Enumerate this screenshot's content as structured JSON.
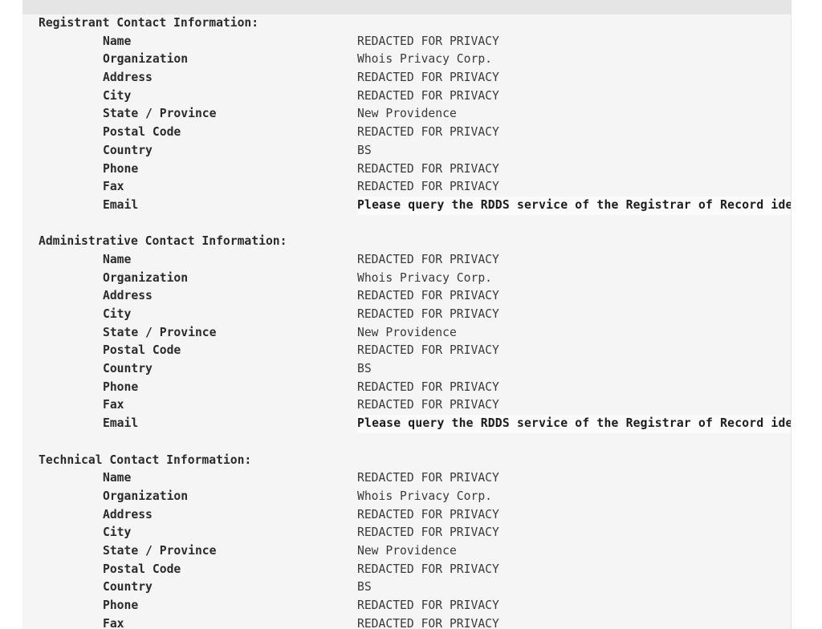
{
  "document": {
    "type": "whois-record",
    "background_color": "#f5f5f5",
    "top_band_color": "#e5e5e5",
    "page_background_color": "#ffffff",
    "text_color": "#2f2f2f"
  },
  "sections": [
    {
      "heading": "Registrant Contact Information:",
      "fields": [
        {
          "label": "Name",
          "value": "REDACTED FOR PRIVACY"
        },
        {
          "label": "Organization",
          "value": "Whois Privacy Corp."
        },
        {
          "label": "Address",
          "value": "REDACTED FOR PRIVACY"
        },
        {
          "label": "City",
          "value": "REDACTED FOR PRIVACY"
        },
        {
          "label": "State / Province",
          "value": "New Providence"
        },
        {
          "label": "Postal Code",
          "value": "REDACTED FOR PRIVACY"
        },
        {
          "label": "Country",
          "value": "BS"
        },
        {
          "label": "Phone",
          "value": "REDACTED FOR PRIVACY"
        },
        {
          "label": "Fax",
          "value": "REDACTED FOR PRIVACY"
        },
        {
          "label": "Email",
          "value": "Please query the RDDS service of the Registrar of Record identified",
          "emphasis": true
        }
      ]
    },
    {
      "heading": "Administrative Contact Information:",
      "fields": [
        {
          "label": "Name",
          "value": "REDACTED FOR PRIVACY"
        },
        {
          "label": "Organization",
          "value": "Whois Privacy Corp."
        },
        {
          "label": "Address",
          "value": "REDACTED FOR PRIVACY"
        },
        {
          "label": "City",
          "value": "REDACTED FOR PRIVACY"
        },
        {
          "label": "State / Province",
          "value": "New Providence"
        },
        {
          "label": "Postal Code",
          "value": "REDACTED FOR PRIVACY"
        },
        {
          "label": "Country",
          "value": "BS"
        },
        {
          "label": "Phone",
          "value": "REDACTED FOR PRIVACY"
        },
        {
          "label": "Fax",
          "value": "REDACTED FOR PRIVACY"
        },
        {
          "label": "Email",
          "value": "Please query the RDDS service of the Registrar of Record identified",
          "emphasis": true
        }
      ]
    },
    {
      "heading": "Technical Contact Information:",
      "fields": [
        {
          "label": "Name",
          "value": "REDACTED FOR PRIVACY"
        },
        {
          "label": "Organization",
          "value": "Whois Privacy Corp."
        },
        {
          "label": "Address",
          "value": "REDACTED FOR PRIVACY"
        },
        {
          "label": "City",
          "value": "REDACTED FOR PRIVACY"
        },
        {
          "label": "State / Province",
          "value": "New Providence"
        },
        {
          "label": "Postal Code",
          "value": "REDACTED FOR PRIVACY"
        },
        {
          "label": "Country",
          "value": "BS"
        },
        {
          "label": "Phone",
          "value": "REDACTED FOR PRIVACY"
        },
        {
          "label": "Fax",
          "value": "REDACTED FOR PRIVACY"
        }
      ]
    }
  ]
}
